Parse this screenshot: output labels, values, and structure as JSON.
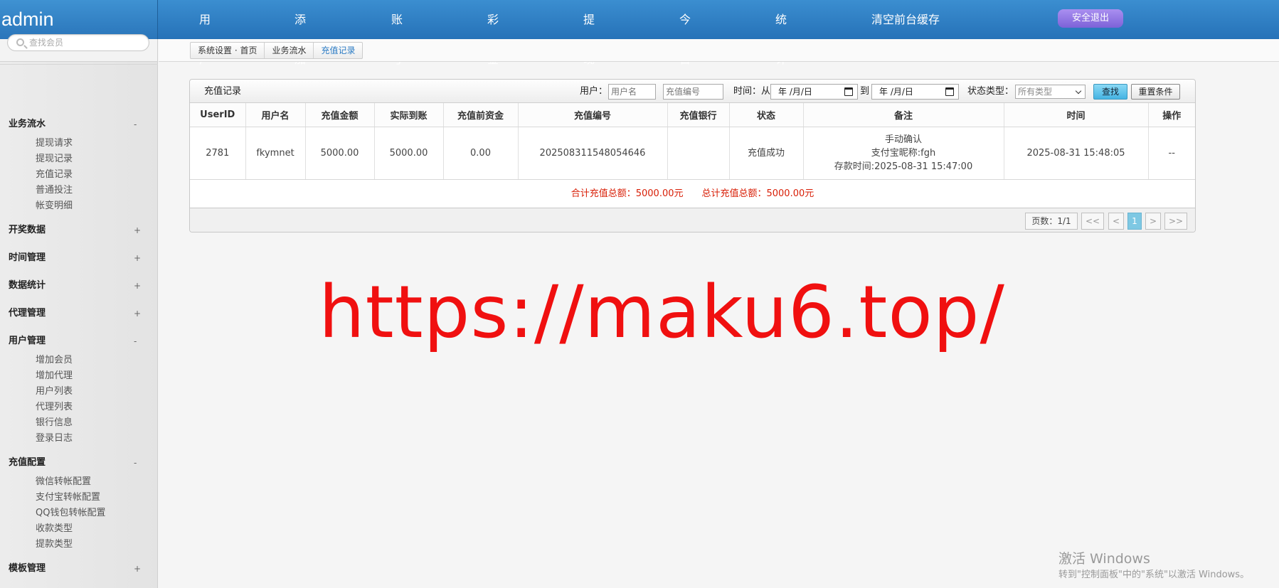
{
  "header": {
    "logo": "admin",
    "nav": [
      "用户列表",
      "添加用户",
      "账号充值",
      "彩金赠送",
      "提现请求",
      "今日统计",
      "统计报表",
      "清空前台缓存"
    ],
    "logout": "安全退出"
  },
  "sidebar": {
    "search_placeholder": "查找会员",
    "groups": [
      {
        "label": "业务流水",
        "toggle": "-",
        "items": [
          "提现请求",
          "提现记录",
          "充值记录",
          "普通投注",
          "帐变明细"
        ]
      },
      {
        "label": "开奖数据",
        "toggle": "+",
        "items": []
      },
      {
        "label": "时间管理",
        "toggle": "+",
        "items": []
      },
      {
        "label": "数据统计",
        "toggle": "+",
        "items": []
      },
      {
        "label": "代理管理",
        "toggle": "+",
        "items": []
      },
      {
        "label": "用户管理",
        "toggle": "-",
        "items": [
          "增加会员",
          "增加代理",
          "用户列表",
          "代理列表",
          "银行信息",
          "登录日志"
        ]
      },
      {
        "label": "充值配置",
        "toggle": "-",
        "items": [
          "微信转帐配置",
          "支付宝转帐配置",
          "QQ钱包转帐配置",
          "收款类型",
          "提款类型"
        ]
      },
      {
        "label": "模板管理",
        "toggle": "+",
        "items": []
      }
    ]
  },
  "breadcrumb": [
    "系统设置 · 首页",
    "业务流水",
    "充值记录"
  ],
  "panel": {
    "title": "充值记录",
    "filters": {
      "user_label": "用户：",
      "user_placeholder": "用户名",
      "order_placeholder": "充值编号",
      "time_label": "时间：从",
      "date_from": "年 /月/日",
      "to_label": "到",
      "date_to": "年 /月/日",
      "status_label": "状态类型：",
      "status_value": "所有类型",
      "search_button": "查找",
      "reset_button": "重置条件"
    },
    "columns": [
      "UserID",
      "用户名",
      "充值金额",
      "实际到账",
      "充值前资金",
      "充值编号",
      "充值银行",
      "状态",
      "备注",
      "时间",
      "操作"
    ],
    "rows": [
      {
        "userid": "2781",
        "username": "fkymnet",
        "amount": "5000.00",
        "actual": "5000.00",
        "before": "0.00",
        "order_no": "202508311548054646",
        "bank": "",
        "status": "充值成功",
        "note_line1": "手动确认",
        "note_line2": "支付宝昵称:fgh",
        "note_line3": "存款时间:2025-08-31 15:47:00",
        "time": "2025-08-31 15:48:05",
        "action": "--"
      }
    ],
    "totals": "合计充值总额：5000.00元　　总计充值总额：5000.00元",
    "pager": {
      "info": "页数：1/1",
      "first": "<<",
      "prev": "<",
      "current": "1",
      "next": ">",
      "last": ">>"
    }
  },
  "overlay": {
    "watermark_url": "https://maku6.top/",
    "activate_title": "激活 Windows",
    "activate_sub": "转到\"控制面板\"中的\"系统\"以激活 Windows。"
  }
}
